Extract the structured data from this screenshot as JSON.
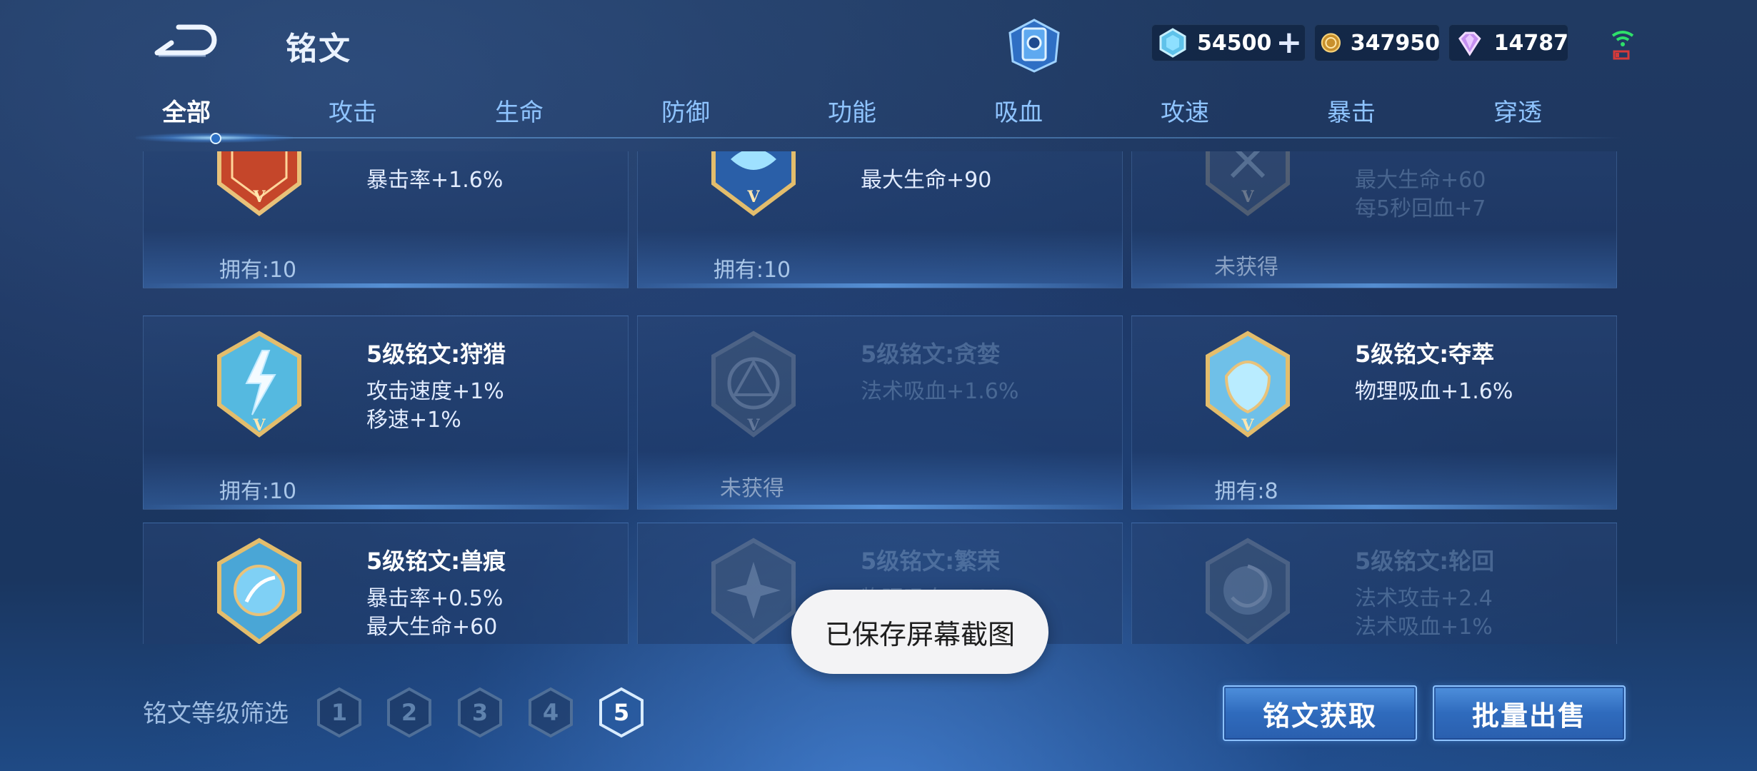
{
  "header": {
    "title": "铭文",
    "resources": {
      "diamond": "54500",
      "gold": "347950",
      "gem": "14787"
    }
  },
  "tabs": [
    "全部",
    "攻击",
    "生命",
    "防御",
    "功能",
    "吸血",
    "攻速",
    "暴击",
    "穿透"
  ],
  "active_tab": "全部",
  "cards": [
    {
      "name": "",
      "stats": [
        "暴击率+1.6%"
      ],
      "owned": "拥有:10",
      "locked": false,
      "color": "#c5462a"
    },
    {
      "name": "",
      "stats": [
        "最大生命+90"
      ],
      "owned": "拥有:10",
      "locked": false,
      "color": "#2a5fa8"
    },
    {
      "name": "",
      "stats": [
        "最大生命+60",
        "每5秒回血+7"
      ],
      "owned": "未获得",
      "locked": true,
      "color": "#2a5fa8"
    },
    {
      "name": "5级铭文:狩猎",
      "stats": [
        "攻击速度+1%",
        "移速+1%"
      ],
      "owned": "拥有:10",
      "locked": false,
      "color": "#55b9e0"
    },
    {
      "name": "5级铭文:贪婪",
      "stats": [
        "法术吸血+1.6%"
      ],
      "owned": "未获得",
      "locked": true,
      "color": "#3b6aa5"
    },
    {
      "name": "5级铭文:夺萃",
      "stats": [
        "物理吸血+1.6%"
      ],
      "owned": "拥有:8",
      "locked": false,
      "color": "#6fc0e8"
    },
    {
      "name": "5级铭文:兽痕",
      "stats": [
        "暴击率+0.5%",
        "最大生命+60"
      ],
      "owned": "",
      "locked": false,
      "color": "#4aa6d6"
    },
    {
      "name": "5级铭文:繁荣",
      "stats": [
        "物理吸血+1%"
      ],
      "owned": "",
      "locked": true,
      "color": "#3b6aa5"
    },
    {
      "name": "5级铭文:轮回",
      "stats": [
        "法术攻击+2.4",
        "法术吸血+1%"
      ],
      "owned": "",
      "locked": true,
      "color": "#3b6aa5"
    }
  ],
  "toast": "已保存屏幕截图",
  "footer": {
    "filter_label": "铭文等级筛选",
    "levels": [
      "1",
      "2",
      "3",
      "4",
      "5"
    ],
    "active_level": "5",
    "get_button": "铭文获取",
    "sell_button": "批量出售"
  }
}
